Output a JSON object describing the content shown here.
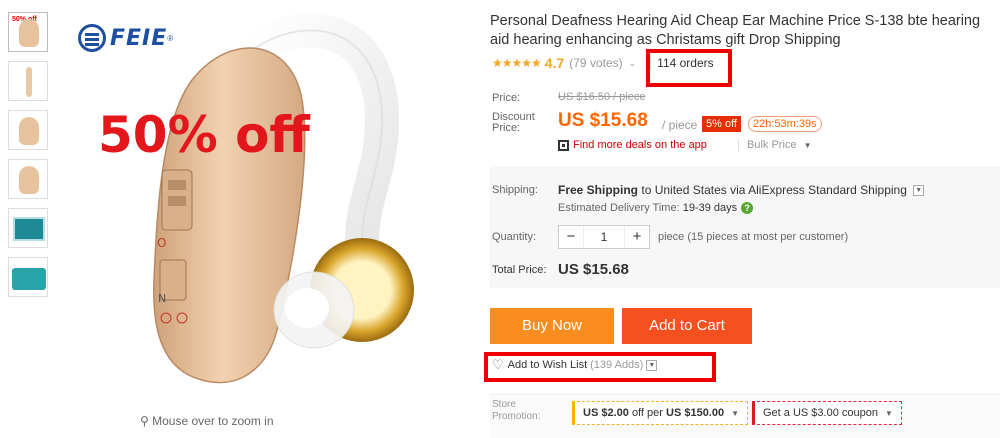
{
  "thumbnails": [
    {
      "name": "thumb-1",
      "tag": "50% off"
    },
    {
      "name": "thumb-2"
    },
    {
      "name": "thumb-3"
    },
    {
      "name": "thumb-4"
    },
    {
      "name": "thumb-5"
    },
    {
      "name": "thumb-6"
    }
  ],
  "image": {
    "brand": "FEIE",
    "brand_mark": "®",
    "promo": "50% off",
    "zoom_hint": "Mouse over to zoom in"
  },
  "product": {
    "title": "Personal Deafness Hearing Aid Cheap Ear Machine Price S-138 bte hearing aid hearing enhancing as Christams gift Drop Shipping",
    "stars": "★★★★★",
    "rating": "4.7",
    "votes": "(79 votes)",
    "orders": "114 orders"
  },
  "pricing": {
    "price_label": "Price:",
    "old_price": "US $16.50 / piece",
    "discount_label_1": "Discount",
    "discount_label_2": "Price:",
    "price": "US $15.68",
    "per": "/ piece",
    "off_badge": "5% off",
    "timer": "22h:53m:39s",
    "app_deal": "Find more deals on the app",
    "bulk": "Bulk Price"
  },
  "shipping": {
    "label": "Shipping:",
    "free": "Free Shipping",
    "to": "to",
    "country": "United States",
    "via": "via AliExpress Standard Shipping",
    "delivery_label": "Estimated Delivery Time:",
    "delivery_time": "19-39 days"
  },
  "quantity": {
    "label": "Quantity:",
    "minus": "−",
    "value": "1",
    "plus": "+",
    "note": "piece (15 pieces at most per customer)"
  },
  "total": {
    "label": "Total Price:",
    "value": "US $15.68"
  },
  "actions": {
    "buy_now": "Buy Now",
    "add_to_cart": "Add to Cart",
    "wishlist": "Add to Wish List",
    "wishlist_adds": "(139 Adds)"
  },
  "store": {
    "label_1": "Store",
    "label_2": "Promotion:",
    "coupon1_a": "US $2.00",
    "coupon1_b": "off per",
    "coupon1_c": "US $150.00",
    "coupon2": "Get a US $3.00 coupon"
  },
  "colors": {
    "accent_orange": "#f60",
    "buy_now": "#f98d1f",
    "add_to_cart": "#f4511e",
    "annotation_red": "#e00"
  }
}
